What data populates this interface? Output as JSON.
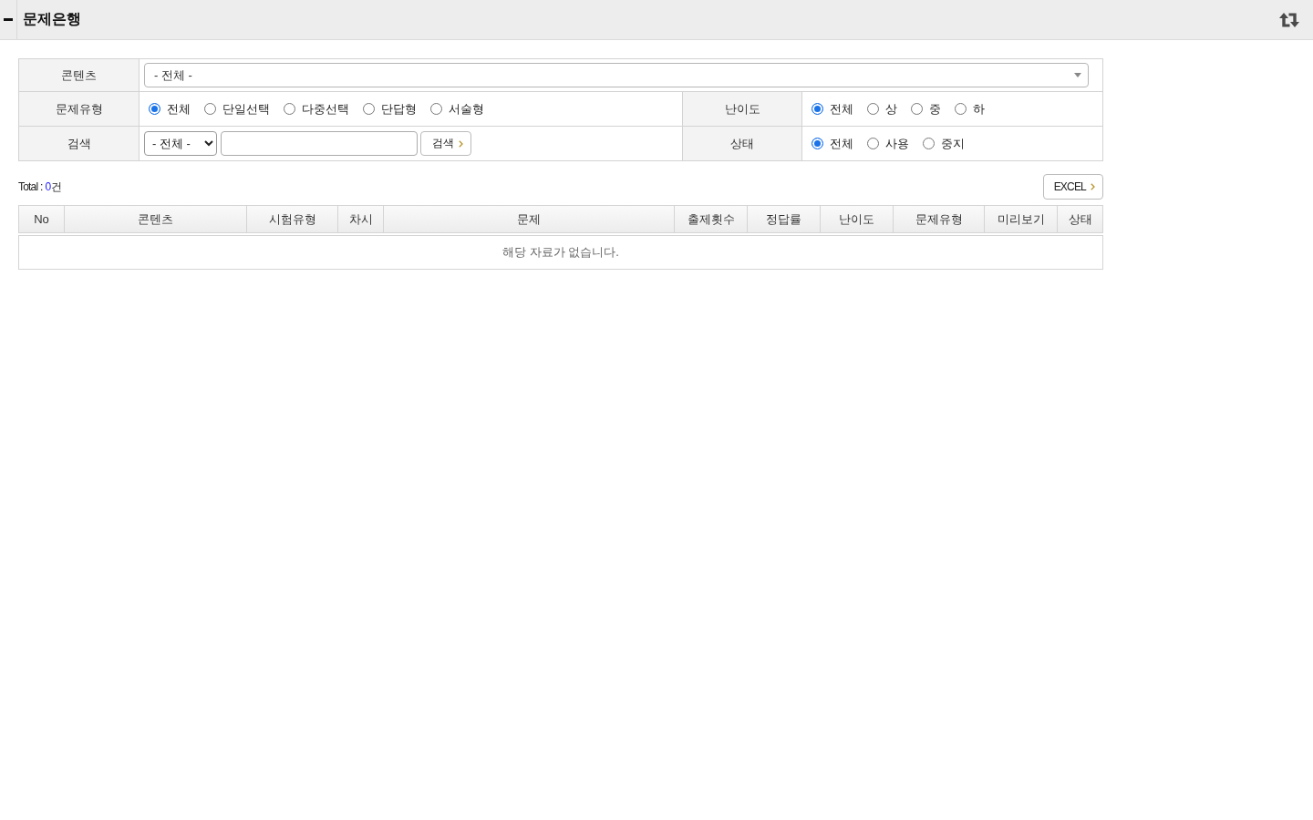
{
  "page_header": {
    "title": "문제은행"
  },
  "filters": {
    "content": {
      "label": "콘텐츠",
      "value": "- 전체 -"
    },
    "question_type": {
      "label": "문제유형",
      "options": [
        {
          "label": "전체",
          "selected": true
        },
        {
          "label": "단일선택",
          "selected": false
        },
        {
          "label": "다중선택",
          "selected": false
        },
        {
          "label": "단답형",
          "selected": false
        },
        {
          "label": "서술형",
          "selected": false
        }
      ]
    },
    "difficulty": {
      "label": "난이도",
      "options": [
        {
          "label": "전체",
          "selected": true
        },
        {
          "label": "상",
          "selected": false
        },
        {
          "label": "중",
          "selected": false
        },
        {
          "label": "하",
          "selected": false
        }
      ]
    },
    "search": {
      "label": "검색",
      "scope": "- 전체 -",
      "button": "검색"
    },
    "status": {
      "label": "상태",
      "options": [
        {
          "label": "전체",
          "selected": true
        },
        {
          "label": "사용",
          "selected": false
        },
        {
          "label": "중지",
          "selected": false
        }
      ]
    }
  },
  "total": {
    "label": "Total :",
    "count": "0",
    "unit": "건"
  },
  "excel_button": "EXCEL",
  "table": {
    "columns": [
      "No",
      "콘텐츠",
      "시험유형",
      "차시",
      "문제",
      "출제횟수",
      "정답률",
      "난이도",
      "문제유형",
      "미리보기",
      "상태"
    ],
    "empty_message": "해당 자료가 없습니다."
  }
}
